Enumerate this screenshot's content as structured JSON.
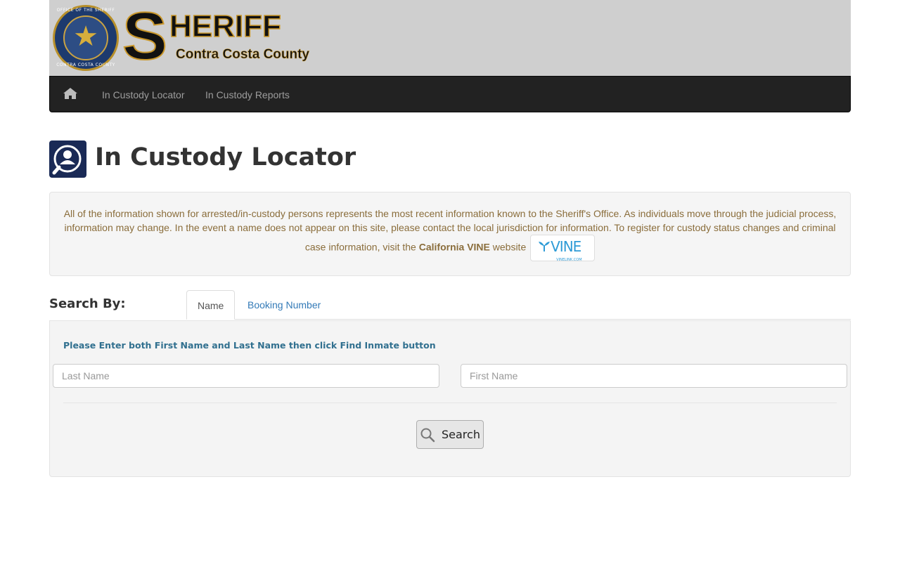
{
  "header": {
    "logo_big_letter": "S",
    "logo_word": "HERIFF",
    "logo_county": "Contra Costa County",
    "seal_top_text": "OFFICE OF THE SHERIFF",
    "seal_bottom_text": "CONTRA COSTA COUNTY",
    "banner_color": "#cfcfcf",
    "brand_gold": "#c9972b"
  },
  "nav": {
    "home_icon": "home-icon",
    "items": [
      {
        "label": "In Custody Locator"
      },
      {
        "label": "In Custody Reports"
      }
    ]
  },
  "page": {
    "title": "In Custody Locator",
    "title_icon": "person-search-icon"
  },
  "notice": {
    "text_before": "All of the information shown for arrested/in-custody persons represents the most recent information known to the Sheriff's Office. As individuals move through the judicial process, information may change. In the event a name does not appear on this site, please contact the local jurisdiction for information. To register for custody status changes and criminal case information, visit the ",
    "vine_strong": "California VINE",
    "text_after": " website",
    "vine_logo_text": "VINE",
    "vine_logo_sub": "VINELINK.COM"
  },
  "search": {
    "search_by_label": "Search By:",
    "tabs": [
      {
        "label": "Name",
        "active": true
      },
      {
        "label": "Booking Number",
        "active": false
      }
    ],
    "instruction": "Please Enter both First Name and Last Name then click Find Inmate button",
    "last_name_placeholder": "Last Name",
    "first_name_placeholder": "First Name",
    "button_label": "Search"
  }
}
